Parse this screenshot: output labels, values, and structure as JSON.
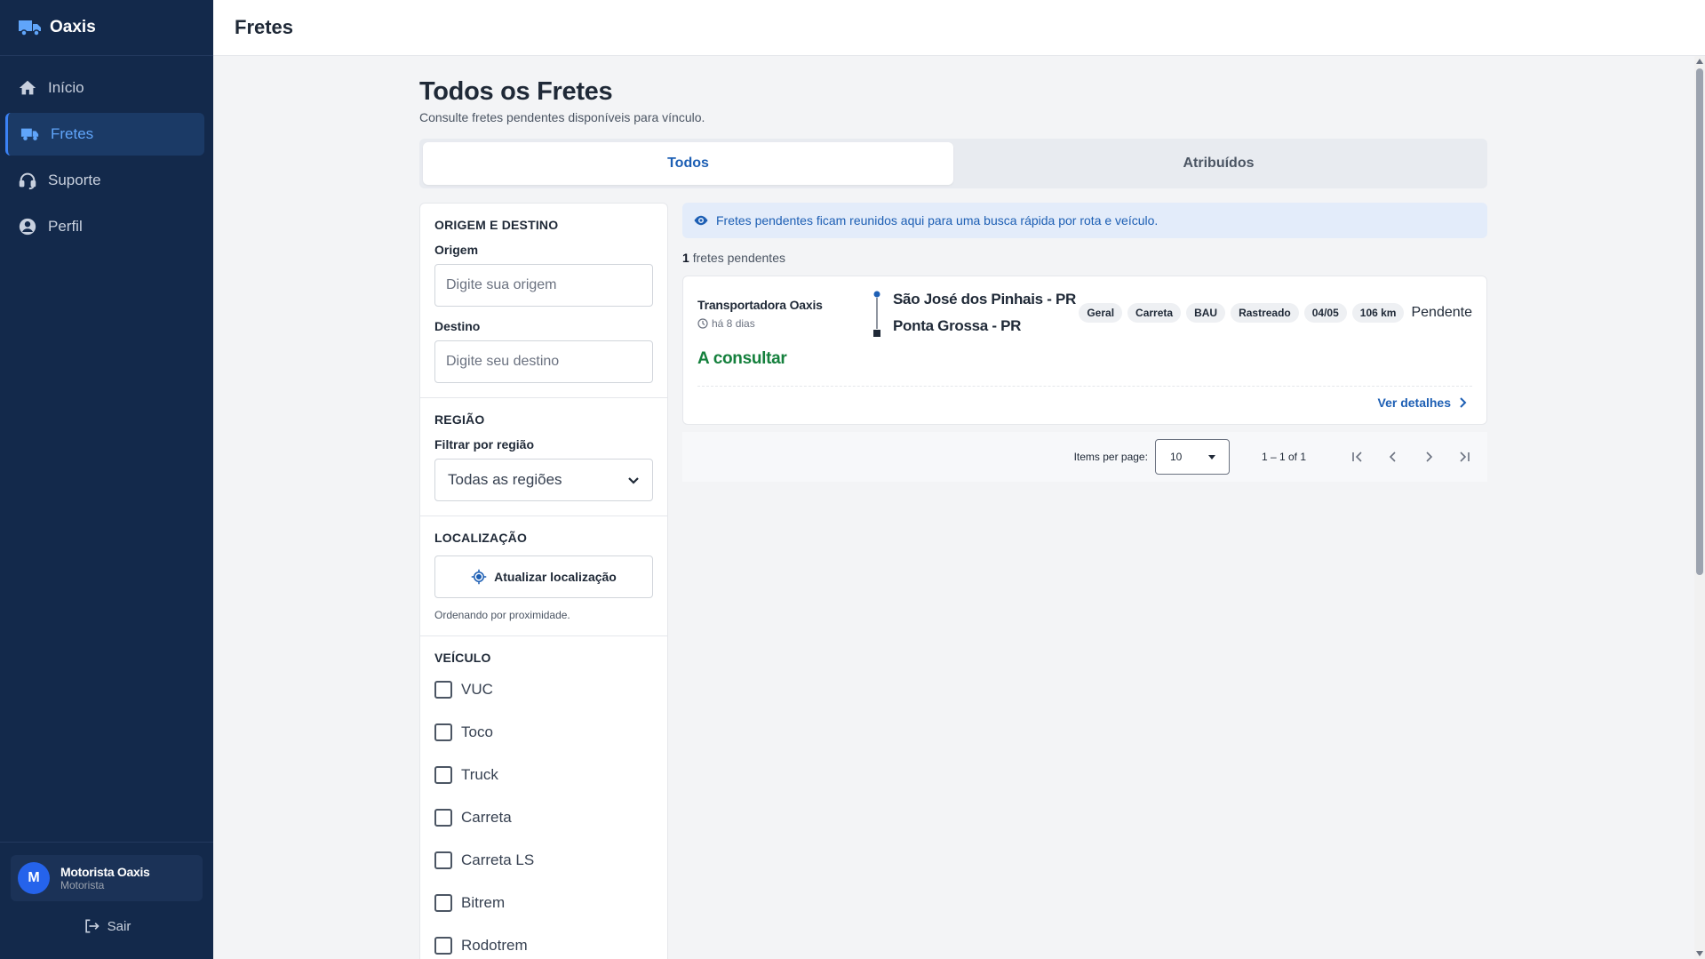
{
  "app": {
    "name": "Oaxis"
  },
  "sidebar": {
    "items": [
      {
        "label": "Início",
        "icon": "home-icon"
      },
      {
        "label": "Fretes",
        "icon": "truck-icon",
        "active": true
      },
      {
        "label": "Suporte",
        "icon": "headset-icon"
      },
      {
        "label": "Perfil",
        "icon": "user-circle-icon"
      }
    ],
    "user": {
      "initial": "M",
      "name": "Motorista Oaxis",
      "role": "Motorista"
    },
    "logout_label": "Sair"
  },
  "header": {
    "title": "Fretes"
  },
  "page": {
    "title": "Todos os Fretes",
    "subtitle": "Consulte fretes pendentes disponíveis para vínculo."
  },
  "tabs": [
    {
      "label": "Todos",
      "active": true
    },
    {
      "label": "Atribuídos",
      "active": false
    }
  ],
  "filters": {
    "origin_destination": {
      "title": "ORIGEM E DESTINO",
      "origin_label": "Origem",
      "origin_placeholder": "Digite sua origem",
      "origin_value": "",
      "destination_label": "Destino",
      "destination_placeholder": "Digite seu destino",
      "destination_value": ""
    },
    "region": {
      "title": "REGIÃO",
      "label": "Filtrar por região",
      "selected": "Todas as regiões"
    },
    "location": {
      "title": "LOCALIZAÇÃO",
      "button_label": "Atualizar localização",
      "note": "Ordenando por proximidade."
    },
    "vehicle": {
      "title": "VEÍCULO",
      "options": [
        "VUC",
        "Toco",
        "Truck",
        "Carreta",
        "Carreta LS",
        "Bitrem",
        "Rodotrem"
      ]
    }
  },
  "results": {
    "info_banner": "Fretes pendentes ficam reunidos aqui para uma busca rápida por rota e veículo.",
    "count": "1",
    "count_label": "fretes pendentes",
    "freights": [
      {
        "carrier": "Transportadora Oaxis",
        "posted": "há 8 dias",
        "price": "A consultar",
        "origin": "São José dos Pinhais - PR",
        "destination": "Ponta Grossa - PR",
        "tags": [
          "Geral",
          "Carreta",
          "BAU",
          "Rastreado",
          "04/05",
          "106 km"
        ],
        "status": "Pendente",
        "details_label": "Ver detalhes"
      }
    ]
  },
  "paginator": {
    "items_per_page_label": "Items per page:",
    "items_per_page": "10",
    "range": "1 – 1 of 1"
  },
  "colors": {
    "sidebar_bg": "#13294b",
    "accent": "#1d5fb4",
    "price_green": "#15803d",
    "banner_bg": "#e3ecfa"
  }
}
